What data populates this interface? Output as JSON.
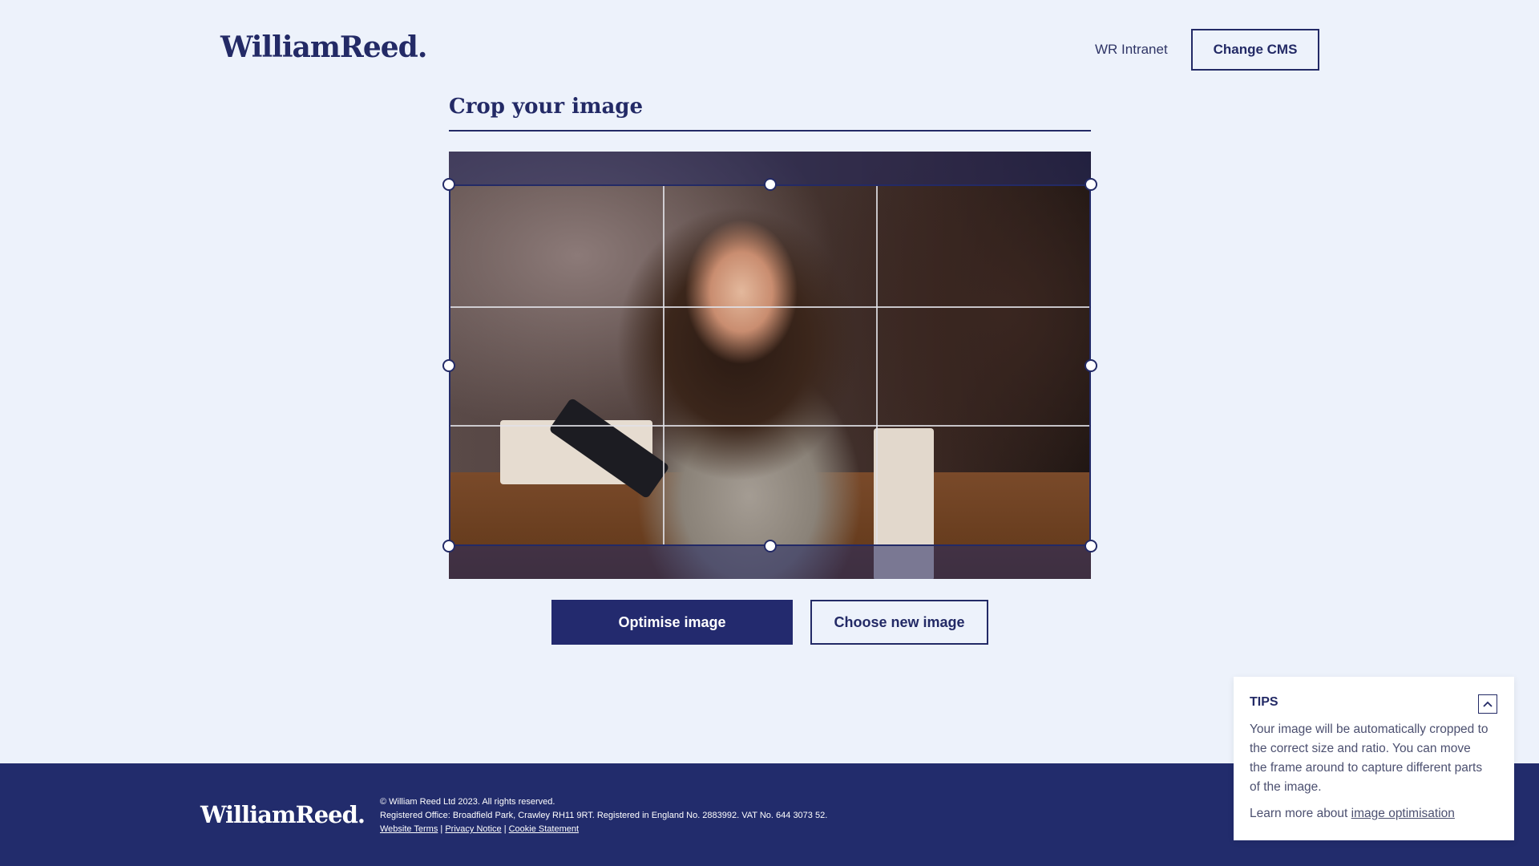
{
  "header": {
    "logo": "WilliamReed.",
    "intranet_link": "WR Intranet",
    "change_cms_label": "Change CMS"
  },
  "main": {
    "title": "Crop your image",
    "optimise_label": "Optimise image",
    "choose_new_label": "Choose new image"
  },
  "tips": {
    "title": "TIPS",
    "toggle_icon": "chevron-up-icon",
    "body": "Your image will be automatically cropped to the correct size and ratio. You can move the frame around to capture different parts of the image.",
    "more_prefix": "Learn more about ",
    "more_link": "image optimisation"
  },
  "footer": {
    "logo": "WilliamReed.",
    "copyright": "© William Reed Ltd 2023. All rights reserved.",
    "registered": "Registered Office: Broadfield Park, Crawley RH11 9RT. Registered in England No. 2883992. VAT No. 644 3073 52.",
    "links": {
      "website_terms": "Website Terms",
      "privacy_notice": "Privacy Notice",
      "cookie_statement": "Cookie Statement"
    },
    "separator": "|"
  },
  "colors": {
    "brand_navy": "#232a66",
    "page_background": "#edf2fb",
    "footer_background": "#222c6c"
  }
}
